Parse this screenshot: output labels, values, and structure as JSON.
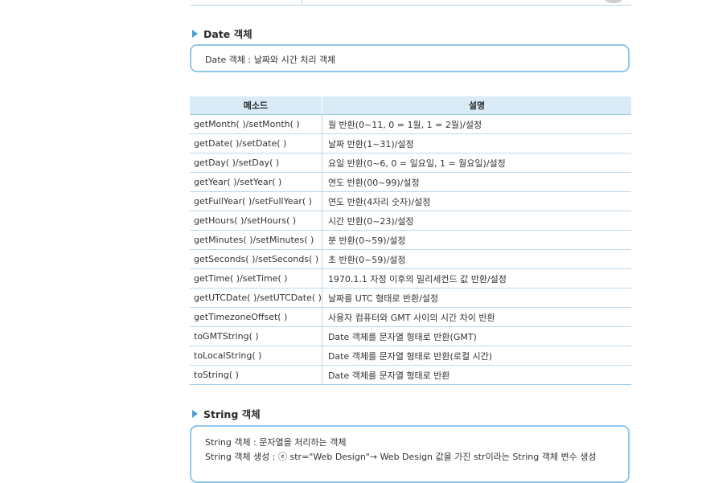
{
  "date_section": {
    "heading": "Date 객체",
    "box_text": "Date 객체 : 날짜와 시간 처리 객체"
  },
  "methods_table": {
    "headers": [
      "메소드",
      "설명"
    ],
    "rows": [
      {
        "method": "getMonth( )/setMonth( )",
        "desc": "월 반환(0~11, 0 = 1월, 1 = 2월)/설정"
      },
      {
        "method": "getDate( )/setDate( )",
        "desc": "날짜 반환(1~31)/설정"
      },
      {
        "method": "getDay( )/setDay( )",
        "desc": "요일 반환(0~6, 0 = 일요일, 1 = 월요일)/설정"
      },
      {
        "method": "getYear( )/setYear( )",
        "desc": "연도 반환(00~99)/설정"
      },
      {
        "method": "getFullYear( )/setFullYear( )",
        "desc": "연도 반환(4자리 숫자)/설정"
      },
      {
        "method": "getHours( )/setHours( )",
        "desc": "시간 반환(0~23)/설정"
      },
      {
        "method": "getMinutes( )/setMinutes( )",
        "desc": "분 반환(0~59)/설정"
      },
      {
        "method": "getSeconds( )/setSeconds( )",
        "desc": "초 반환(0~59)/설정"
      },
      {
        "method": "getTime( )/setTime( )",
        "desc": "1970.1.1 자정 이후의 밀리세컨드 값 반환/설정"
      },
      {
        "method": "getUTCDate( )/setUTCDate( )",
        "desc": "날짜를 UTC 형태로 반환/설정"
      },
      {
        "method": "getTimezoneOffset( )",
        "desc": "사용자 컴퓨터와 GMT 사이의 시간 차이 반환"
      },
      {
        "method": "toGMTString( )",
        "desc": "Date 객체를 문자열 형태로 반환(GMT)"
      },
      {
        "method": "toLocalString( )",
        "desc": "Date 객체를 문자열 형태로 반환(로컬 시간)"
      },
      {
        "method": "toString( )",
        "desc": "Date 객체를 문자열 형태로 반환"
      }
    ]
  },
  "string_section": {
    "heading": "String 객체",
    "box_line1": "String 객체 : 문자열을 처리하는 객체",
    "box_line2": "String 객체 생성 : ⓔ str=\"Web Design\"→ Web Design 값을 가진 str이라는 String 객체 변수 생성"
  },
  "colors": {
    "accent": "#4a9fd8",
    "box_border": "#8fc6ea",
    "table_header_bg": "#d9ebf7",
    "table_line": "#bcd9ee"
  }
}
